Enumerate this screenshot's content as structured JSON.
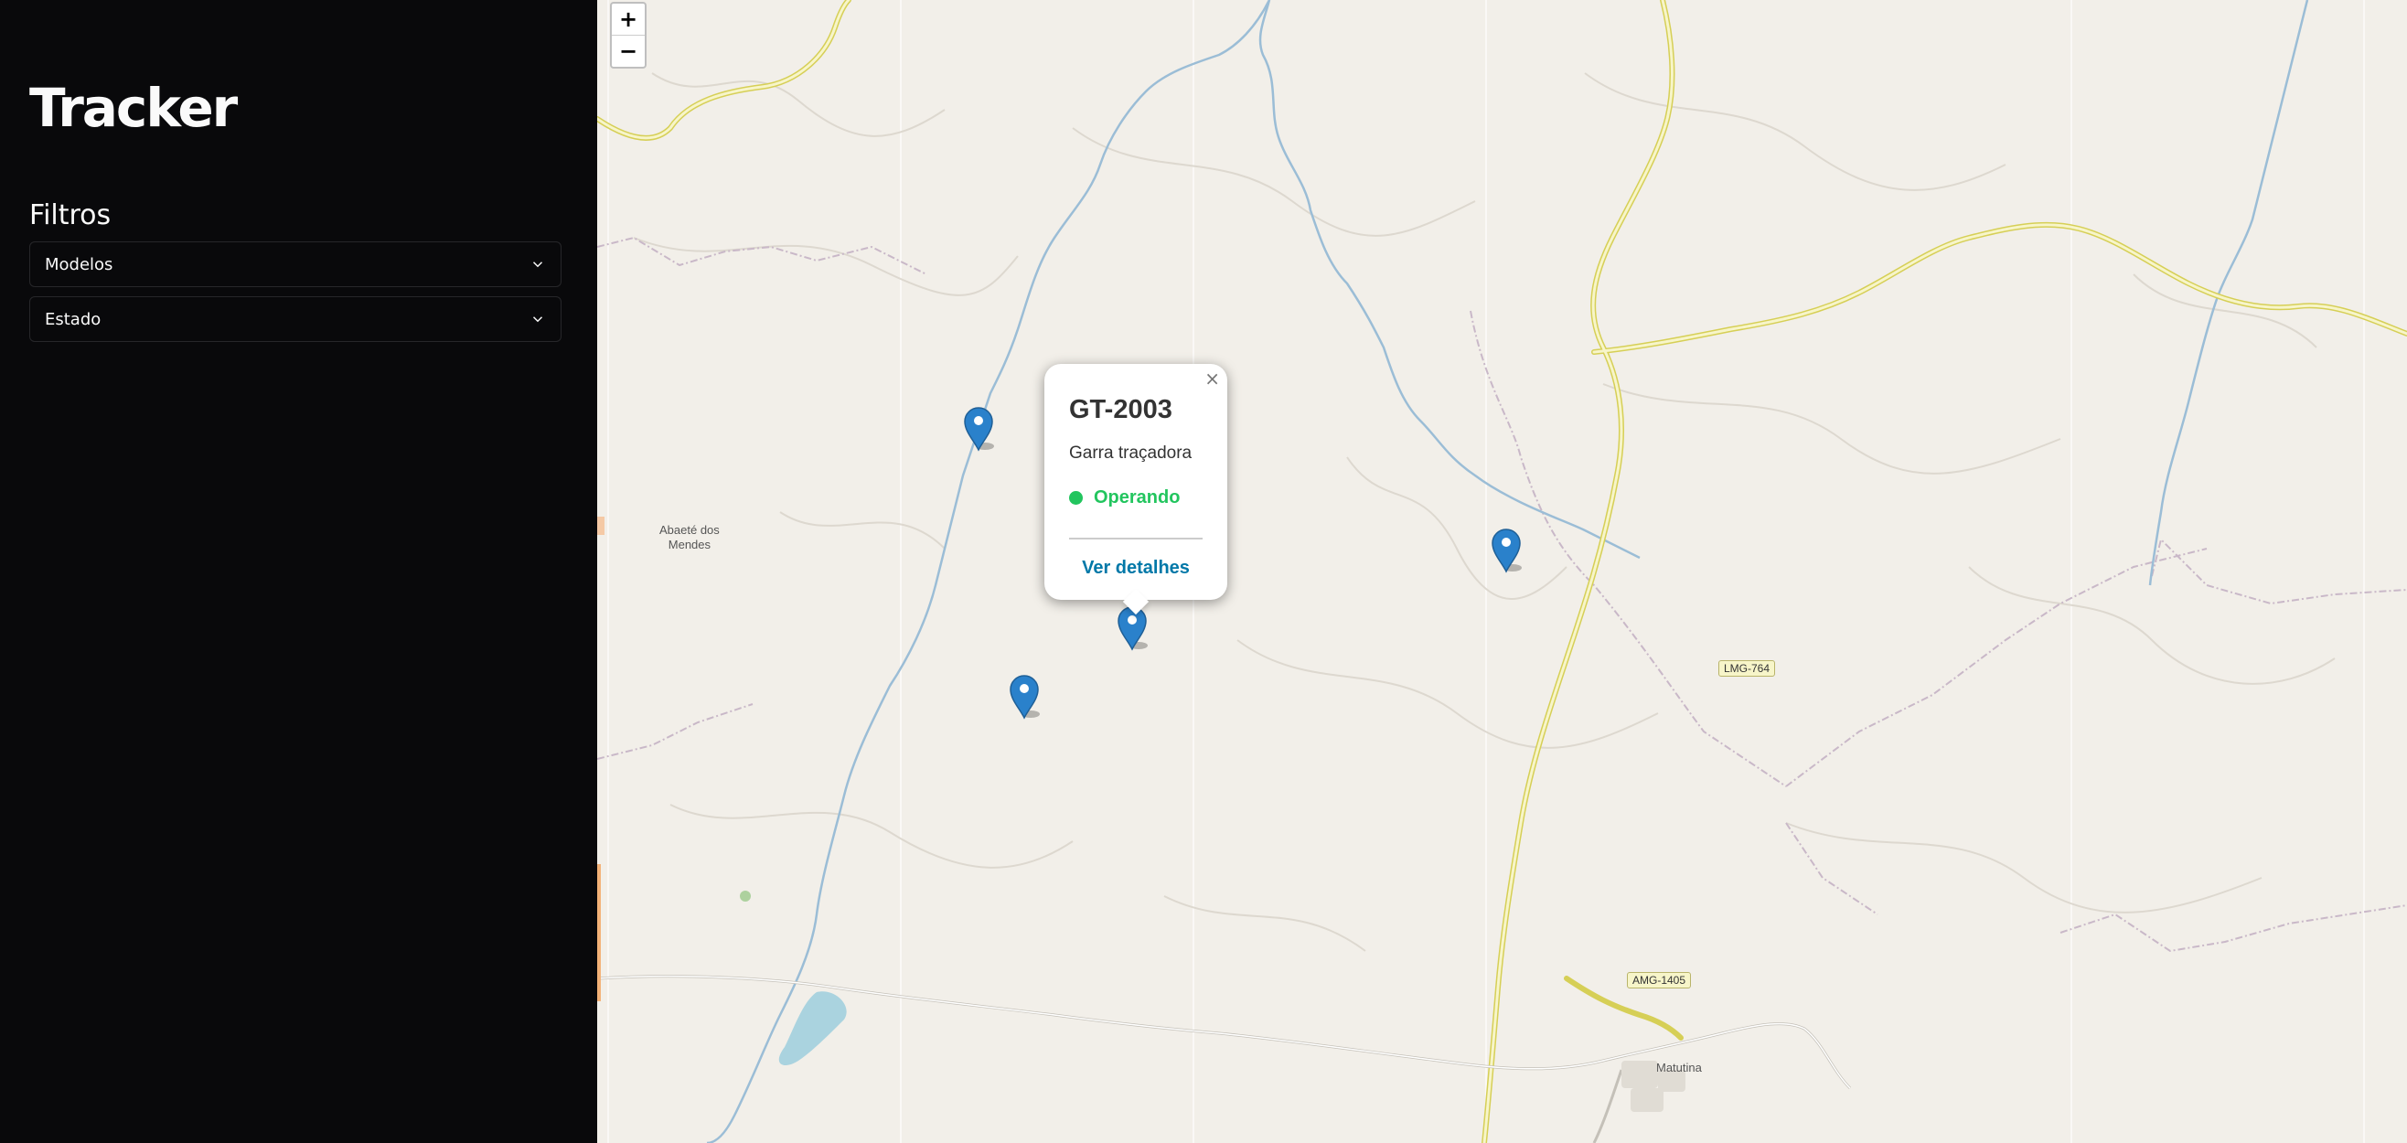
{
  "sidebar": {
    "title": "Tracker",
    "filters_title": "Filtros",
    "filters": [
      {
        "label": "Modelos"
      },
      {
        "label": "Estado"
      }
    ]
  },
  "map": {
    "zoom_in": "+",
    "zoom_out": "−",
    "place_labels": {
      "abaete": "Abaeté dos\nMendes",
      "matutina": "Matutina"
    },
    "road_shields": {
      "lmg764": "LMG-764",
      "amg1405": "AMG-1405"
    },
    "popup": {
      "close": "×",
      "id": "GT-2003",
      "model": "Garra traçadora",
      "status": "Operando",
      "status_color": "#22c55e",
      "link": "Ver detalhes"
    },
    "marker_color": "#2a81cb"
  }
}
